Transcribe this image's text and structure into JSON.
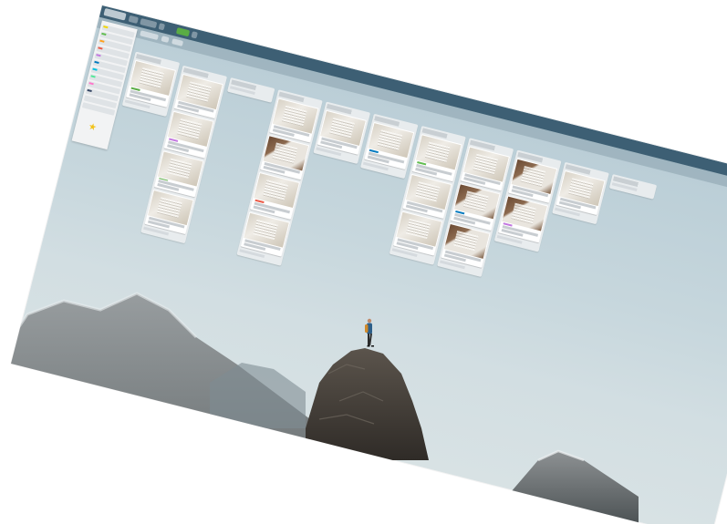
{
  "app": {
    "accent": "#3d5f74",
    "create_color": "#5aac44"
  },
  "board": {
    "lists": [
      {
        "cards": [
          {
            "thumb": "doc",
            "label": "#5aac44"
          }
        ]
      },
      {
        "cards": [
          {
            "thumb": "doc"
          },
          {
            "thumb": "doc",
            "label": "#c377e0"
          },
          {
            "thumb": "doc",
            "label": "#5aac44"
          },
          {
            "thumb": "doc"
          }
        ]
      },
      {
        "cards": []
      },
      {
        "cards": [
          {
            "thumb": "doc"
          },
          {
            "thumb": "dark"
          },
          {
            "thumb": "doc",
            "label": "#eb5a46"
          },
          {
            "thumb": "doc"
          }
        ]
      },
      {
        "cards": [
          {
            "thumb": "doc"
          }
        ]
      },
      {
        "cards": [
          {
            "thumb": "doc",
            "label": "#0079bf"
          }
        ]
      },
      {
        "cards": [
          {
            "thumb": "doc",
            "label": "#61bd4f"
          },
          {
            "thumb": "doc"
          },
          {
            "thumb": "doc"
          }
        ]
      },
      {
        "cards": [
          {
            "thumb": "doc"
          },
          {
            "thumb": "dark",
            "label": "#0079bf"
          },
          {
            "thumb": "dark"
          }
        ]
      },
      {
        "cards": [
          {
            "thumb": "dark"
          },
          {
            "thumb": "dark",
            "label": "#c377e0"
          }
        ]
      },
      {
        "cards": [
          {
            "thumb": "doc"
          }
        ]
      },
      {
        "cards": []
      }
    ]
  }
}
